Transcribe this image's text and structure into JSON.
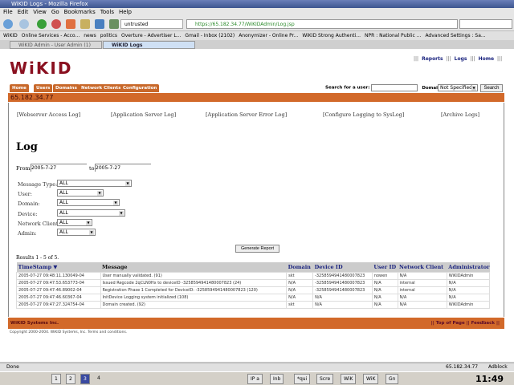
{
  "window": {
    "title": "WiKID Logs - Mozilla Firefox"
  },
  "menu": [
    "File",
    "Edit",
    "View",
    "Go",
    "Bookmarks",
    "Tools",
    "Help"
  ],
  "toolbar": {
    "profile": "untrusted",
    "url": "https://65.182.34.77/WiKIDAdmin/Log.jsp"
  },
  "bookmarks": [
    "WiKID",
    "Online Services - Acco...",
    "news",
    "politics",
    "Overture - Advertiser L...",
    "Gmail - Inbox (2102)",
    "Anonymizer - Online Pr...",
    "WiKID Strong Authenti...",
    "NPR : National Public ...",
    "Advanced Settings : Sa..."
  ],
  "tabs": [
    {
      "label": "WiKID Admin - User Admin (1)",
      "active": false
    },
    {
      "label": "WiKID Logs",
      "active": true
    }
  ],
  "page": {
    "logo": "WiKID",
    "top_links": [
      "Reports",
      "Logs",
      "Home"
    ],
    "nav_tabs": [
      "Home",
      "Users",
      "Domains",
      "Network Clients",
      "Configuration"
    ],
    "search": {
      "label": "Search for a user:",
      "value": "",
      "domain_label": "Domain:",
      "domain_value": "Not Specified",
      "button": "Search"
    },
    "server_ip": "65.182.34.77",
    "log_links": [
      "[Webserver Access Log]",
      "[Application Server Log]",
      "[Application Server Error Log]",
      "[Configure Logging to SysLog]",
      "[Archive Logs]"
    ],
    "heading": "Log",
    "from_label": "From",
    "from_value": "2005-7-27",
    "to_label": "to",
    "to_value": "2005-7-27",
    "filters": [
      {
        "label": "Message Type:",
        "value": "ALL"
      },
      {
        "label": "User:",
        "value": "ALL"
      },
      {
        "label": "Domain:",
        "value": "ALL"
      },
      {
        "label": "Device:",
        "value": "ALL"
      },
      {
        "label": "Network Client:",
        "value": "ALL"
      },
      {
        "label": "Admin:",
        "value": "ALL"
      }
    ],
    "generate_button": "Generate Report",
    "results": "Results 1 - 5 of 5.",
    "columns": [
      "TimeStamp",
      "Message",
      "Domain",
      "Device ID",
      "User ID",
      "Network Client",
      "Administrator"
    ],
    "rows": [
      [
        "2005-07-27 09:48:11.130049-04",
        "User manually validated. (91)",
        "skt",
        "-3258594941480007823",
        "nowen",
        "N/A",
        "WiKIDAdmin"
      ],
      [
        "2005-07-27 09:47:53.653773-04",
        "Issued Regcode 2qCLN0Hx to deviceID -3258594941480007823 (24)",
        "N/A",
        "-3258594941480007823",
        "N/A",
        "internal",
        "N/A"
      ],
      [
        "2005-07-27 09:47:46.89002-04",
        "Registration Phase 1 Completed for DeviceID: -3258594941480007823 (120)",
        "N/A",
        "-3258594941480007823",
        "N/A",
        "internal",
        "N/A"
      ],
      [
        "2005-07-27 09:47:46.60367-04",
        "InitDevice Logging system initialized (108)",
        "N/A",
        "N/A",
        "N/A",
        "N/A",
        "N/A"
      ],
      [
        "2005-07-27 09:47:27.324754-04",
        "Domain created. (92)",
        "skt",
        "N/A",
        "N/A",
        "N/A",
        "WiKIDAdmin"
      ]
    ],
    "footer": {
      "company": "WiKID Systems Inc.",
      "links": [
        "Top of Page",
        "Feedback"
      ]
    },
    "copyright": "Copyright 2000-2004. WiKID Systems, Inc. Terms and conditions."
  },
  "status": {
    "text": "Done",
    "ip": "65.182.34.77",
    "adblock": "Adblock"
  },
  "taskbar": {
    "workspaces": [
      "1",
      "2",
      "3",
      "4"
    ],
    "tasks": [
      "IP a",
      "Inb",
      "*qui",
      "Scre",
      "WiK",
      "WiK",
      "Gn"
    ],
    "clock": "11:49"
  },
  "colors": {
    "accent": "#d2692a",
    "link": "#1a237e",
    "logo": "#8a1020"
  }
}
